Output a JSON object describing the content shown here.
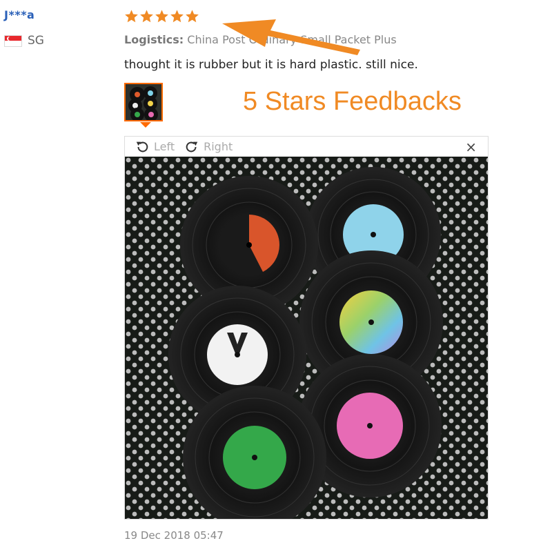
{
  "reviewer": {
    "name": "J***a",
    "country_code": "SG"
  },
  "review": {
    "rating": 5,
    "logistics_label": "Logistics:",
    "logistics_value": "China Post Ordinary Small Packet Plus",
    "comment": "thought it is rubber but it is hard plastic. still nice.",
    "timestamp": "19 Dec 2018 05:47"
  },
  "annotation": {
    "headline": "5 Stars Feedbacks",
    "accent_color": "#f08a24"
  },
  "viewer": {
    "rotate_left_label": "Left",
    "rotate_right_label": "Right",
    "close_label": "×"
  },
  "icons": {
    "star": "star-icon",
    "rotate_left": "rotate-left-icon",
    "rotate_right": "rotate-right-icon",
    "close": "close-icon",
    "flag": "singapore-flag-icon"
  }
}
